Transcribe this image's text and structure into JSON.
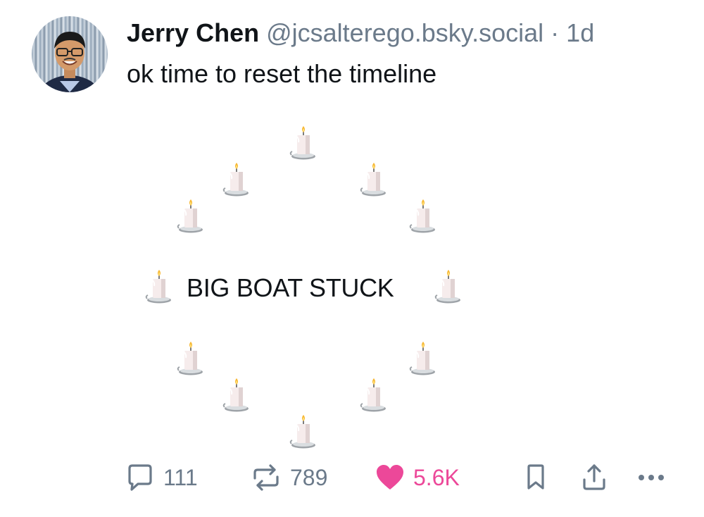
{
  "post": {
    "author_name": "Jerry Chen",
    "handle": "@jcsalterego.bsky.social",
    "separator": "·",
    "age": "1d",
    "text": "ok time to reset the timeline",
    "image_text": "BIG BOAT STUCK"
  },
  "actions": {
    "reply_count": "111",
    "repost_count": "789",
    "like_count": "5.6K",
    "liked": true,
    "like_color": "#ec4899",
    "icons": [
      "reply-icon",
      "repost-icon",
      "heart-icon",
      "bookmark-icon",
      "share-icon",
      "more-icon"
    ]
  },
  "colors": {
    "text": "#101418",
    "muted": "#6b7a8a",
    "accent_like": "#ec4899"
  }
}
